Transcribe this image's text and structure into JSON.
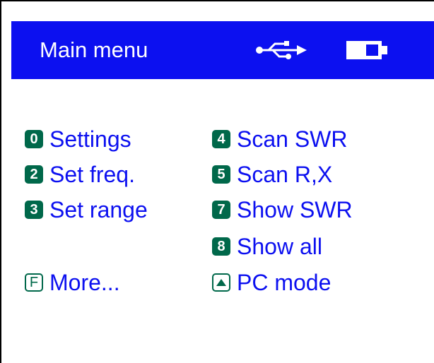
{
  "header": {
    "title": "Main menu",
    "usb_icon": "usb-icon",
    "battery_icon": "battery-icon"
  },
  "menu": {
    "left": [
      {
        "key": "0",
        "label": "Settings"
      },
      {
        "key": "2",
        "label": "Set freq."
      },
      {
        "key": "3",
        "label": "Set range"
      },
      {
        "key": "F",
        "label": "More..."
      }
    ],
    "right": [
      {
        "key": "4",
        "label": "Scan SWR"
      },
      {
        "key": "5",
        "label": "Scan R,X"
      },
      {
        "key": "7",
        "label": "Show SWR"
      },
      {
        "key": "8",
        "label": "Show all"
      },
      {
        "key_icon": "up-arrow-key-icon",
        "label": "PC mode"
      }
    ]
  },
  "colors": {
    "header_bg": "#0c10f0",
    "header_text": "#ffffff",
    "menu_text": "#0c10f0",
    "key_badge": "#00684a"
  }
}
